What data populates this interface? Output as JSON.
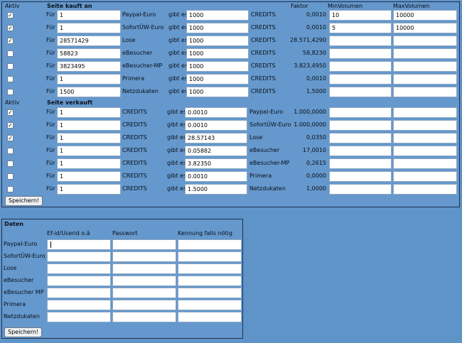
{
  "buy": {
    "col_aktiv": "Aktiv",
    "title": "Seite kauft an",
    "col_faktor": "Faktor",
    "col_min": "MinVolumen",
    "col_max": "MaxVolumen",
    "rows": [
      {
        "checked": true,
        "fuer": "Für",
        "amount": "1",
        "currency": "Paypal-Euro",
        "gibt": "gibt es",
        "credits_amount": "1000",
        "target": "CREDITS",
        "faktor": "0,0010",
        "min": "10",
        "max": "10000"
      },
      {
        "checked": true,
        "fuer": "Für",
        "amount": "1",
        "currency": "SofortÜW-Euro",
        "gibt": "gibt es",
        "credits_amount": "1000",
        "target": "CREDITS",
        "faktor": "0,0010",
        "min": "5",
        "max": "10000"
      },
      {
        "checked": true,
        "fuer": "Für",
        "amount": "28571429",
        "currency": "Lose",
        "gibt": "gibt es",
        "credits_amount": "1000",
        "target": "CREDITS",
        "faktor": "28.571,4290",
        "min": "",
        "max": ""
      },
      {
        "checked": false,
        "fuer": "Für",
        "amount": "58823",
        "currency": "eBesucher",
        "gibt": "gibt es",
        "credits_amount": "1000",
        "target": "CREDITS",
        "faktor": "58,8230",
        "min": "",
        "max": ""
      },
      {
        "checked": false,
        "fuer": "Für",
        "amount": "3823495",
        "currency": "eBesucher-MP",
        "gibt": "gibt es",
        "credits_amount": "1000",
        "target": "CREDITS",
        "faktor": "3.823,4950",
        "min": "",
        "max": ""
      },
      {
        "checked": false,
        "fuer": "Für",
        "amount": "1",
        "currency": "Primera",
        "gibt": "gibt es",
        "credits_amount": "1000",
        "target": "CREDITS",
        "faktor": "0,0010",
        "min": "",
        "max": ""
      },
      {
        "checked": false,
        "fuer": "Für",
        "amount": "1500",
        "currency": "Netzdukaten",
        "gibt": "gibt es",
        "credits_amount": "1000",
        "target": "CREDITS",
        "faktor": "1,5000",
        "min": "",
        "max": ""
      }
    ]
  },
  "sell": {
    "col_aktiv": "Aktiv",
    "title": "Seite verkauft",
    "rows": [
      {
        "checked": true,
        "fuer": "Für",
        "amount": "1",
        "currency": "CREDITS",
        "gibt": "gibt es",
        "value": "0.0010",
        "target": "Paypal-Euro",
        "faktor": "1.000,0000",
        "min": "",
        "max": ""
      },
      {
        "checked": true,
        "fuer": "Für",
        "amount": "1",
        "currency": "CREDITS",
        "gibt": "gibt es",
        "value": "0.0010",
        "target": "SofortÜW-Euro",
        "faktor": "1.000,0000",
        "min": "",
        "max": ""
      },
      {
        "checked": true,
        "fuer": "Für",
        "amount": "1",
        "currency": "CREDITS",
        "gibt": "gibt es",
        "value": "28.57143",
        "target": "Lose",
        "faktor": "0,0350",
        "min": "",
        "max": ""
      },
      {
        "checked": false,
        "fuer": "Für",
        "amount": "1",
        "currency": "CREDITS",
        "gibt": "gibt es",
        "value": "0.05882",
        "target": "eBesucher",
        "faktor": "17,0010",
        "min": "",
        "max": ""
      },
      {
        "checked": false,
        "fuer": "Für",
        "amount": "1",
        "currency": "CREDITS",
        "gibt": "gibt es",
        "value": "3.82350",
        "target": "eBesucher-MP",
        "faktor": "0,2615",
        "min": "",
        "max": ""
      },
      {
        "checked": false,
        "fuer": "Für",
        "amount": "1",
        "currency": "CREDITS",
        "gibt": "gibt es",
        "value": "0.0010",
        "target": "Primera",
        "faktor": "0,0000",
        "min": "",
        "max": ""
      },
      {
        "checked": false,
        "fuer": "Für",
        "amount": "1",
        "currency": "CREDITS",
        "gibt": "gibt es",
        "value": "1.5000",
        "target": "Netzdukaten",
        "faktor": "1,0000",
        "min": "",
        "max": ""
      }
    ],
    "save_label": "Speichern!"
  },
  "daten": {
    "title": "Daten",
    "col_email": "Ef-id/Userid o.ä",
    "col_password": "Passwort",
    "col_kennung": "Kennung falls nötig",
    "rows": [
      {
        "label": "Paypal-Euro",
        "email": "",
        "password": "",
        "kennung": ""
      },
      {
        "label": "SofortÜW-Euro",
        "email": "",
        "password": "",
        "kennung": ""
      },
      {
        "label": "Lose",
        "email": "",
        "password": "",
        "kennung": ""
      },
      {
        "label": "eBesucher",
        "email": "",
        "password": "",
        "kennung": ""
      },
      {
        "label": "eBesucher MP",
        "email": "",
        "password": "",
        "kennung": ""
      },
      {
        "label": "Primera",
        "email": "",
        "password": "",
        "kennung": ""
      },
      {
        "label": "Netzdukaten",
        "email": "",
        "password": "",
        "kennung": ""
      }
    ],
    "save_label": "Speichern!"
  }
}
